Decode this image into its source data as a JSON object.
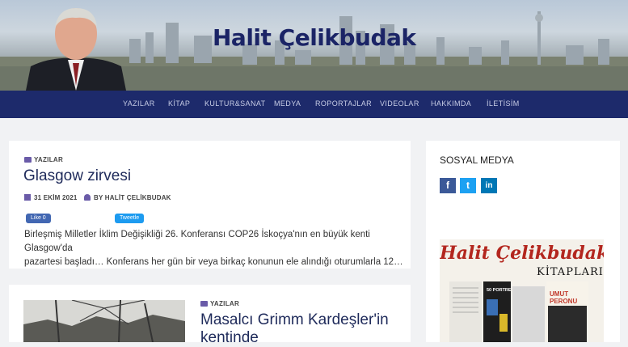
{
  "site": {
    "title": "Halit Çelikbudak"
  },
  "nav": {
    "items": [
      "YAZILAR",
      "KİTAP",
      "KULTUR&SANAT",
      "MEDYA",
      "ROPORTAJLAR",
      "VIDEOLAR",
      "HAKKIMDA",
      "İLETİSİM"
    ]
  },
  "posts": [
    {
      "category": "YAZILAR",
      "title": "Glasgow zirvesi",
      "date": "31 EKİM 2021",
      "author": "BY HALİT ÇELİKBUDAK",
      "like_label": "Like 0",
      "tweet_label": "Tweetle",
      "excerpt_line1": "Birleşmiş Milletler İklim Değişikliği 26. Konferansı COP26 İskoçya'nın en büyük kenti Glasgow'da",
      "excerpt_line2": "pazartesi başladı… Konferans her gün bir veya birkaç konunun ele alındığı oturumlarla 12…"
    },
    {
      "category": "YAZILAR",
      "title_line1": "Masalcı Grimm Kardeşler'in",
      "title_line2": "kentinde"
    }
  ],
  "sidebar": {
    "social_title": "SOSYAL MEDYA",
    "social": [
      {
        "icon": "facebook-icon",
        "glyph": "f",
        "color": "#3b5998"
      },
      {
        "icon": "twitter-icon",
        "glyph": "t",
        "color": "#1da1f2"
      },
      {
        "icon": "linkedin-icon",
        "glyph": "in",
        "color": "#0077b5"
      }
    ],
    "books_title": "Halit Çelikbudak",
    "books_subtitle": "KİTAPLARI",
    "book_labels": [
      "50 PORTRE",
      "UMUT PERONU"
    ]
  },
  "colors": {
    "nav_bg": "#1d2a6b",
    "title": "#1b2466",
    "accent": "#6a5ba8"
  }
}
